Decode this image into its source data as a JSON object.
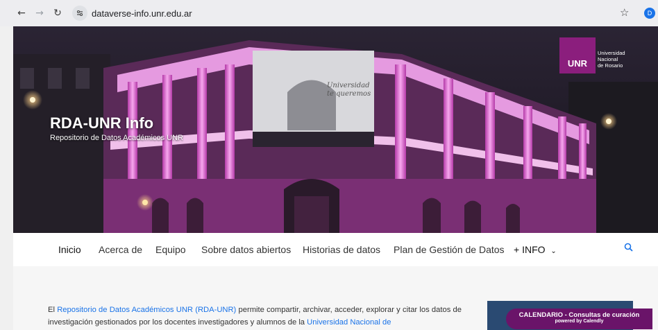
{
  "browser": {
    "url": "dataverse-info.unr.edu.ar",
    "profile_initial": "D"
  },
  "hero": {
    "title": "RDA-UNR Info",
    "subtitle": "Repositorio de Datos Académicos UNR",
    "logo": {
      "mark": "UNR",
      "line1": "Universidad",
      "line2": "Nacional",
      "line3": "de Rosario"
    },
    "banner_text_line1": "Universidad",
    "banner_text_line2": "te queremos"
  },
  "nav": {
    "items": [
      {
        "label": "Inicio"
      },
      {
        "label": "Acerca de"
      },
      {
        "label": "Equipo"
      },
      {
        "label": "Sobre datos abiertos"
      },
      {
        "label": "Historias de datos"
      },
      {
        "label": "Plan de Gestión de Datos"
      },
      {
        "label": "+ INFO"
      }
    ]
  },
  "content": {
    "intro_prefix": "El ",
    "intro_link1": "Repositorio de Datos Académicos UNR (RDA-UNR)",
    "intro_mid": " permite compartir, archivar, acceder, explorar y citar los datos de investigación gestionados por los docentes investigadores y alumnos de la ",
    "intro_link2": "Universidad Nacional de"
  },
  "calendly": {
    "line1": "CALENDARIO - Consultas de curación",
    "line2": "powered by Calendly"
  },
  "colors": {
    "accent_link": "#1a73e8",
    "brand": "#8b1e7d",
    "calendly": "#6a1469",
    "side_box": "#2a4a72"
  }
}
